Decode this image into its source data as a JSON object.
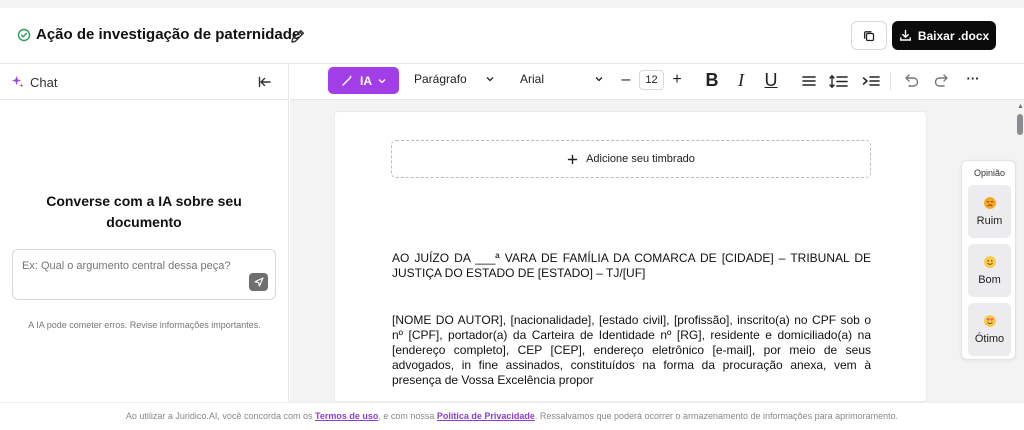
{
  "header": {
    "title": "Ação de investigação de paternidade",
    "download_label": "Baixar .docx"
  },
  "sidebar": {
    "tab_label": "Chat",
    "heading": "Converse com a IA sobre seu documento",
    "input_placeholder": "Ex: Qual o argumento central dessa peça?",
    "disclaimer": "A IA pode cometer erros. Revise informações importantes."
  },
  "toolbar": {
    "ia_label": "IA",
    "paragraph_style": "Parágrafo",
    "font_name": "Arial",
    "font_size": "12",
    "decrease_glyph": "–",
    "increase_glyph": "+",
    "bold_glyph": "B",
    "italic_glyph": "I",
    "underline_glyph": "U",
    "more_glyph": "···"
  },
  "document": {
    "letterhead_label": "Adicione seu timbrado",
    "paragraph_1": "AO JUÍZO DA ___ª VARA DE FAMÍLIA DA COMARCA DE [CIDADE] – TRIBUNAL DE JUSTIÇA DO ESTADO DE [ESTADO] – TJ/[UF]",
    "paragraph_2": "[NOME DO AUTOR], [nacionalidade], [estado civil], [profissão], inscrito(a) no CPF sob o nº [CPF], portador(a) da Carteira de Identidade nº [RG], residente e domiciliado(a) na [endereço completo], CEP [CEP], endereço eletrônico [e-mail], por meio de seus advogados, in fine assinados, constituídos na forma da procuração anexa, vem à presença de Vossa Excelência propor"
  },
  "feedback": {
    "title": "Opinião",
    "options": [
      {
        "label": "Ruim",
        "color": "#f5a623"
      },
      {
        "label": "Bom",
        "color": "#f7c948"
      },
      {
        "label": "Ótimo",
        "color": "#f05a7e"
      }
    ]
  },
  "footer": {
    "text_before": "Ao utilizar a Juridico.AI, você concorda com os ",
    "terms_link": "Termos de uso",
    "text_middle": ", e com nossa ",
    "privacy_link": "Política de Privacidade",
    "text_after": ". Ressalvamos que poderá ocorrer o armazenamento de informações para aprimoramento."
  },
  "colors": {
    "accent": "#a23ee8",
    "primary_button": "#0b0b0c",
    "status_ok": "#2e9e5b"
  }
}
